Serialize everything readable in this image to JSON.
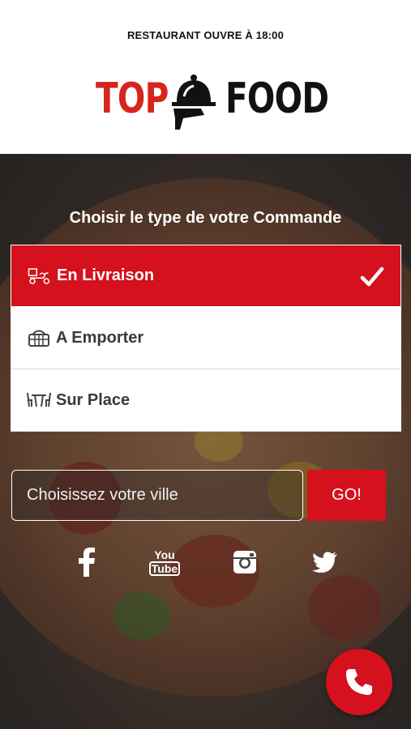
{
  "status": {
    "text": "RESTAURANT OUVRE À 18:00"
  },
  "logo": {
    "left": "TOP",
    "right": "FOOD"
  },
  "order": {
    "title": "Choisir le type de votre Commande",
    "options": [
      {
        "label": "En Livraison",
        "icon": "delivery-scooter-icon",
        "selected": true
      },
      {
        "label": "A Emporter",
        "icon": "basket-icon",
        "selected": false
      },
      {
        "label": "Sur Place",
        "icon": "dining-table-icon",
        "selected": false
      }
    ]
  },
  "city": {
    "placeholder": "Choisissez votre ville",
    "value": "",
    "go_label": "GO!"
  },
  "social": {
    "youtube_top": "You",
    "youtube_bottom": "Tube"
  },
  "colors": {
    "accent": "#d4111d",
    "logo_red": "#d5251d",
    "text_dark": "#3a3a3a"
  }
}
